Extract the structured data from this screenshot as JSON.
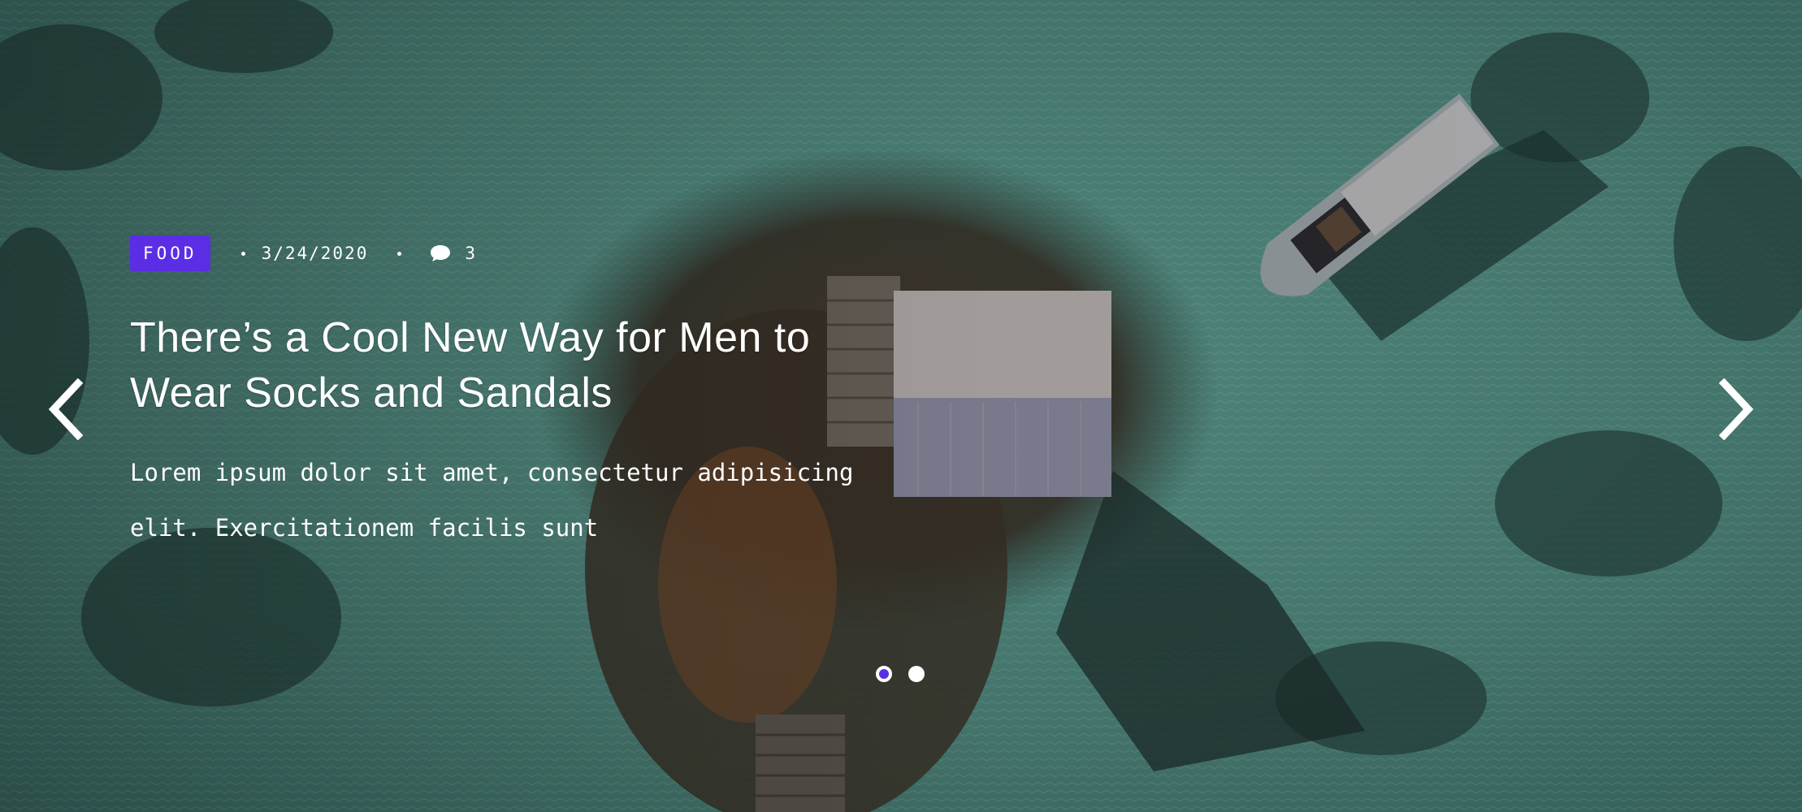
{
  "slide": {
    "category": "FOOD",
    "date": "3/24/2020",
    "comments": "3",
    "title": "There’s a Cool New Way for Men to Wear Socks and Sandals",
    "excerpt": "Lorem ipsum dolor sit amet, consectetur adipisicing elit. Exercitationem facilis sunt"
  },
  "pagination": {
    "total": 2,
    "active": 1
  },
  "icons": {
    "prev": "chevron-left-icon",
    "next": "chevron-right-icon",
    "comment": "comment-icon"
  },
  "colors": {
    "accent": "#5b2ee6",
    "text": "#ffffff",
    "water": "#4a8a80"
  }
}
